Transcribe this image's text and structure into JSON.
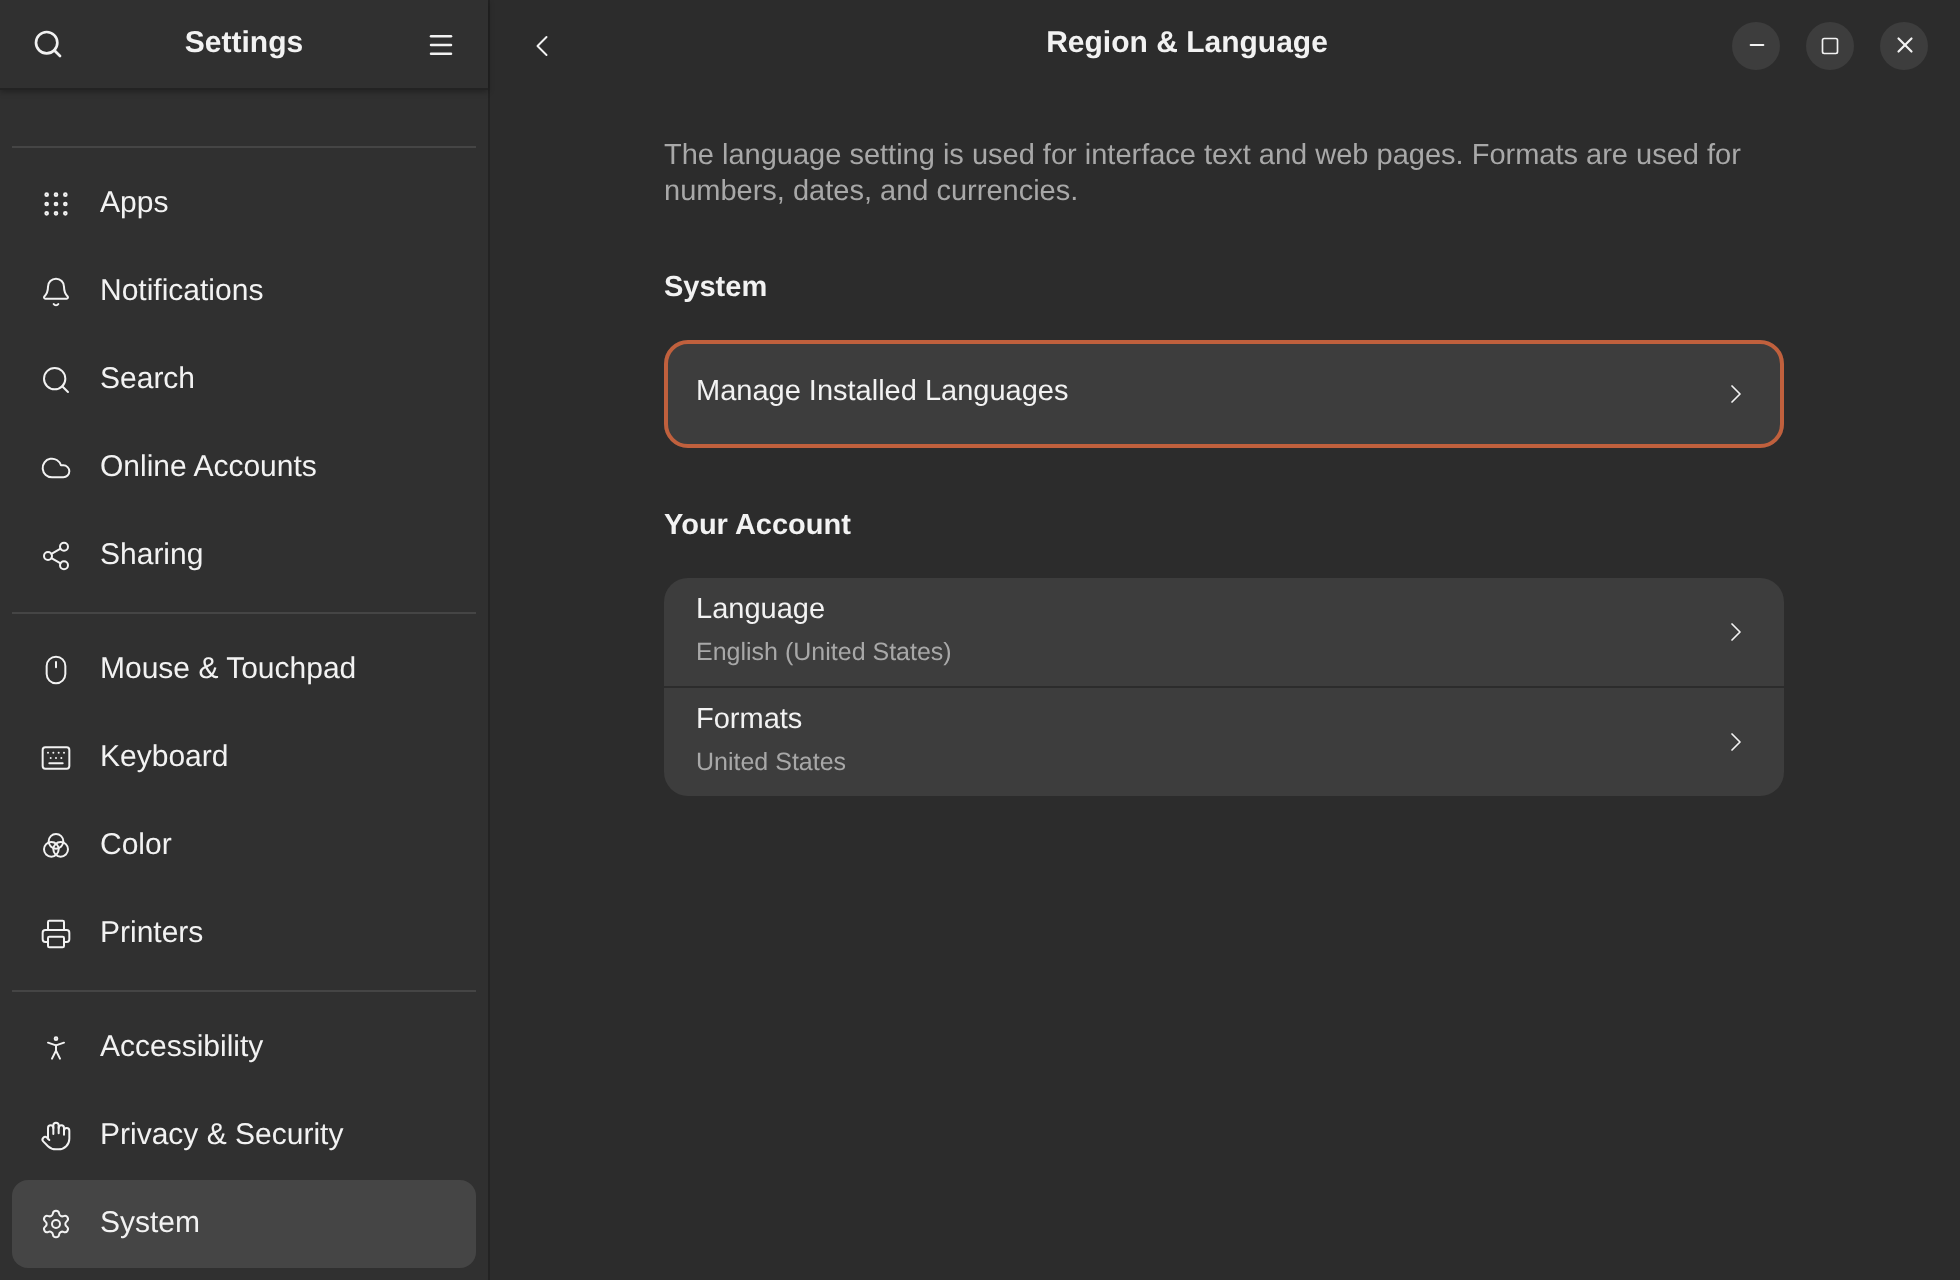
{
  "sidebar": {
    "title": "Settings",
    "groups": [
      {
        "items": [
          {
            "label": "Apps",
            "selected": false
          },
          {
            "label": "Notifications",
            "selected": false
          },
          {
            "label": "Search",
            "selected": false
          },
          {
            "label": "Online Accounts",
            "selected": false
          },
          {
            "label": "Sharing",
            "selected": false
          }
        ]
      },
      {
        "items": [
          {
            "label": "Mouse & Touchpad",
            "selected": false
          },
          {
            "label": "Keyboard",
            "selected": false
          },
          {
            "label": "Color",
            "selected": false
          },
          {
            "label": "Printers",
            "selected": false
          }
        ]
      },
      {
        "items": [
          {
            "label": "Accessibility",
            "selected": false
          },
          {
            "label": "Privacy & Security",
            "selected": false
          },
          {
            "label": "System",
            "selected": true
          }
        ]
      }
    ]
  },
  "page": {
    "title": "Region & Language",
    "description": "The language setting is used for interface text and web pages. Formats are used for numbers, dates, and currencies.",
    "sections": [
      {
        "title": "System",
        "rows": [
          {
            "title": "Manage Installed Languages",
            "focused": true
          }
        ]
      },
      {
        "title": "Your Account",
        "rows": [
          {
            "title": "Language",
            "subtitle": "English (United States)",
            "focused": false
          },
          {
            "title": "Formats",
            "subtitle": "United States",
            "focused": false
          }
        ]
      }
    ]
  }
}
